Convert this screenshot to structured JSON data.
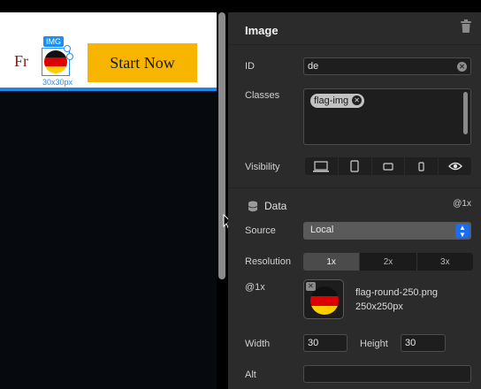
{
  "preview": {
    "fr_text": "Fr",
    "img_badge": "IMG",
    "img_dimensions": "30x30px",
    "start_button": "Start Now"
  },
  "panel": {
    "title": "Image",
    "id_label": "ID",
    "id_value": "de",
    "classes_label": "Classes",
    "class_chips": [
      "flag-img"
    ],
    "visibility_label": "Visibility",
    "visibility_icons": [
      "desktop-icon",
      "tablet-portrait-icon",
      "tablet-landscape-icon",
      "phone-icon",
      "eye-icon"
    ],
    "data_section_title": "Data",
    "data_section_resolution": "@1x",
    "source_label": "Source",
    "source_value": "Local",
    "resolution_label": "Resolution",
    "resolution_options": [
      "1x",
      "2x",
      "3x"
    ],
    "resolution_selected": "1x",
    "image_slot_label": "@1x",
    "file_name": "flag-round-250.png",
    "file_size": "250x250px",
    "width_label": "Width",
    "width_value": "30",
    "height_label": "Height",
    "height_value": "30",
    "alt_label": "Alt",
    "alt_value": ""
  },
  "colors": {
    "accent": "#1f86e6",
    "button_bg": "#f7b500",
    "panel_bg": "#2b2b2b",
    "canvas_bg": "#06090e",
    "flag_black": "#111111",
    "flag_red": "#dd0000",
    "flag_gold": "#ffce00"
  }
}
